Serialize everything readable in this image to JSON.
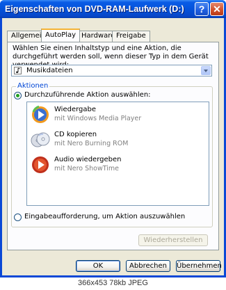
{
  "window": {
    "title": "Eigenschaften von DVD-RAM-Laufwerk (D:)",
    "help_glyph": "?",
    "close_glyph": "✕",
    "accent_color": "#0a48d6"
  },
  "tabs": [
    {
      "label": "Allgemein",
      "active": false
    },
    {
      "label": "AutoPlay",
      "active": true
    },
    {
      "label": "Hardware",
      "active": false
    },
    {
      "label": "Freigabe",
      "active": false
    }
  ],
  "autoplay": {
    "description": "Wählen Sie einen Inhaltstyp und eine Aktion, die durchgeführt werden soll, wenn dieser Typ in dem Gerät verwendet wird:",
    "content_type": {
      "selected": "Musikdateien",
      "icon": "music-file-icon"
    },
    "group_label": "Aktionen",
    "select_action_label": "Durchzuführende Aktion auswählen:",
    "select_action_checked": true,
    "actions": [
      {
        "title": "Wiedergabe",
        "subtitle": "mit Windows Media Player",
        "icon": "media-player-icon"
      },
      {
        "title": "CD kopieren",
        "subtitle": "mit Nero Burning ROM",
        "icon": "cd-copy-icon"
      },
      {
        "title": "Audio wiedergeben",
        "subtitle": "mit Nero ShowTime",
        "icon": "nero-showtime-icon"
      }
    ],
    "prompt_label": "Eingabeaufforderung, um Aktion auszuwählen",
    "prompt_checked": false,
    "restore_button": "Wiederherstellen"
  },
  "footer": {
    "ok": "OK",
    "cancel": "Abbrechen",
    "apply": "Übernehmen"
  },
  "image_caption": "366x453 78kb JPEG"
}
